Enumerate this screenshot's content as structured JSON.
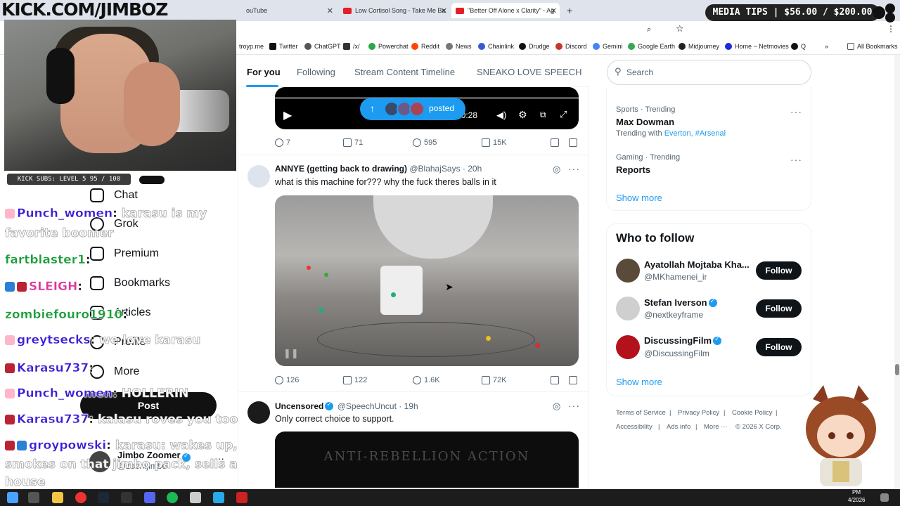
{
  "overlay": {
    "kick_title": "KICK.COM/JIMBOZ",
    "subs_text": "KICK SUBS: LEVEL 5 95 / 100",
    "media_tips": "MEDIA TIPS | $56.00 / $200.00",
    "chat": [
      {
        "user": "Punch_women",
        "msg": "karasu is my",
        "color": "#3a1fd6"
      },
      {
        "user": "",
        "msg": "favorite boomer",
        "color": "#3a1fd6"
      },
      {
        "user": "fartblaster1",
        "msg": "",
        "color": "#1a9e3a"
      },
      {
        "user": "SLEIGH",
        "msg": "",
        "color": "#e2329a"
      },
      {
        "user": "zombiefouro1910",
        "msg": "",
        "color": "#1a9e3a"
      },
      {
        "user": "greytsecks",
        "msg": "we love karasu",
        "color": "#3a1fd6"
      },
      {
        "user": "Karasu737",
        "msg": "",
        "color": "#3a1fd6"
      },
      {
        "user": "Punch_women",
        "msg": "HOLLERIN",
        "color": "#3a1fd6"
      },
      {
        "user": "Karasu737",
        "msg": "kalasu roves you too",
        "color": "#3a1fd6"
      },
      {
        "user": "groypowski",
        "msg": "karasu: wakes up,",
        "color": "#3a1fd6"
      },
      {
        "user": "",
        "msg": "smokes on that jimbo pack, sells a",
        "color": "#3a1fd6"
      },
      {
        "user": "",
        "msg": "house",
        "color": "#3a1fd6"
      }
    ]
  },
  "browser": {
    "tabs": [
      {
        "label": "ouTube"
      },
      {
        "label": "Low Cortisol Song - Take Me Ba"
      },
      {
        "label": "\"Better Off Alone x Clarity\" - Ag"
      }
    ],
    "new_tab": "+",
    "bookmarks": [
      "troyp.me",
      "Twitter",
      "ChatGPT",
      "/x/",
      "Powerchat",
      "Reddit",
      "News",
      "Chainlink",
      "Drudge",
      "Discord",
      "Gemini",
      "Google Earth",
      "Midjourney",
      "Home ~ Netmovies",
      "Q"
    ],
    "all_bookmarks": "All Bookmarks"
  },
  "nav": {
    "items": [
      "Chat",
      "Grok",
      "Premium",
      "Bookmarks",
      "Articles",
      "Profile",
      "More"
    ],
    "post": "Post",
    "account_name": "Jimbo Zoomer",
    "account_handle": "@zoomjimbo"
  },
  "feed": {
    "tabs": [
      "For you",
      "Following",
      "Stream Content Timeline",
      "SNEAKO LOVE SPEECH"
    ],
    "posted_pill": "posted",
    "posts": [
      {
        "time_display": "/ 0:28",
        "replies": "7",
        "reposts": "71",
        "likes": "595",
        "views": "15K"
      },
      {
        "name": "ANNYE (getting back to drawing)",
        "handle": "@BlahajSays",
        "time": "· 20h",
        "text": "what is this machine for??? why the fuck theres balls in it",
        "replies": "126",
        "reposts": "122",
        "likes": "1.6K",
        "views": "72K"
      },
      {
        "name": "Uncensored",
        "handle": "@SpeechUncut",
        "time": "· 19h",
        "text": "Only correct choice to support.",
        "video_text": "ANTI-REBELLION ACTION"
      }
    ]
  },
  "sidebar": {
    "search_placeholder": "Search",
    "trends": [
      {
        "meta": "Sports · Trending",
        "name": "Max Dowman",
        "sub_prefix": "Trending with",
        "sub_links": "Everton, #Arsenal"
      },
      {
        "meta": "Gaming · Trending",
        "name": "Reports"
      }
    ],
    "show_more": "Show more",
    "who_to_follow": "Who to follow",
    "follow_label": "Follow",
    "suggestions": [
      {
        "name": "Ayatollah Mojtaba Kha...",
        "handle": "@MKhamenei_ir"
      },
      {
        "name": "Stefan Iverson",
        "handle": "@nextkeyframe"
      },
      {
        "name": "DiscussingFilm",
        "handle": "@DiscussingFilm"
      }
    ],
    "footer": [
      "Terms of Service",
      "|",
      "Privacy Policy",
      "|",
      "Cookie Policy",
      "|",
      "Accessibility",
      "|",
      "Ads info",
      "|",
      "More ···",
      "© 2026 X Corp."
    ]
  },
  "taskbar": {
    "time": "PM",
    "date": "4/2026"
  }
}
